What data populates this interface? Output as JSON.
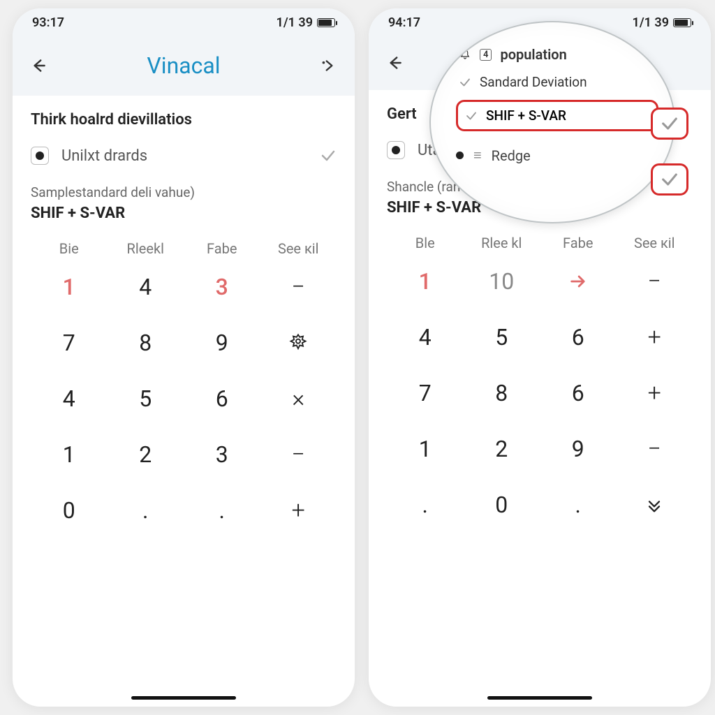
{
  "left": {
    "status": {
      "time": "93:17",
      "signal": "1/1 39"
    },
    "nav": {
      "title": "Vinacal"
    },
    "heading": "Thirk hoalrd dievillatios",
    "option_label": "Unilxt drards",
    "small_label": "Samplestandard deli vahue)",
    "combo_label": "SHIF + S-VAR",
    "headers": [
      "Bie",
      "Rleekl",
      "Fabe",
      "See кіl"
    ],
    "keys": [
      [
        "1",
        "4",
        "3",
        "−"
      ],
      [
        "7",
        "8",
        "9",
        "⚙"
      ],
      [
        "4",
        "5",
        "6",
        "×"
      ],
      [
        "1",
        "2",
        "3",
        "−"
      ],
      [
        "0",
        ".",
        ".",
        "+"
      ]
    ]
  },
  "right": {
    "status": {
      "time": "94:17",
      "signal": "1/1 39"
    },
    "heading": "Gert",
    "option_label": "Utaifı. Redge",
    "small_label": "Shancle (ranc. kia defvitiue)",
    "combo_label": "SHIF + S-VAR",
    "headers": [
      "Ble",
      "Rlee kl",
      "Fabe",
      "See кіl"
    ],
    "keys": [
      [
        "1",
        "10",
        "→",
        "−"
      ],
      [
        "4",
        "5",
        "6",
        "+"
      ],
      [
        "7",
        "8",
        "6",
        "+"
      ],
      [
        "1",
        "2",
        "9",
        "−"
      ],
      [
        ".",
        "0",
        ".",
        "⌄"
      ]
    ]
  },
  "magnifier": {
    "head": "population",
    "head_badge": "4",
    "row1": "Sandard Deviation",
    "highlight": "SHIF + S-VAR",
    "bottom": "Redge"
  }
}
